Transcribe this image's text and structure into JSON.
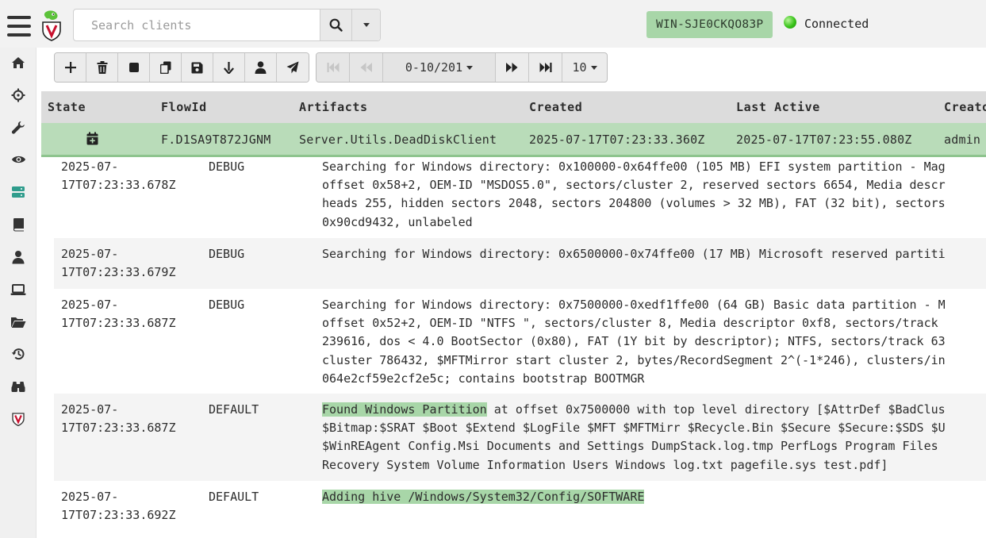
{
  "app": {
    "search_placeholder": "Search clients",
    "client_id": "WIN-SJE0CKQO83P",
    "connection_status": "Connected"
  },
  "sidebar": {
    "items": [
      {
        "name": "home",
        "icon": "home-icon"
      },
      {
        "name": "hunt",
        "icon": "crosshair-icon"
      },
      {
        "name": "tools",
        "icon": "wrench-icon"
      },
      {
        "name": "view",
        "icon": "eye-icon"
      },
      {
        "name": "servers",
        "icon": "server-icon",
        "active": true
      },
      {
        "name": "notebook",
        "icon": "book-icon"
      },
      {
        "name": "users",
        "icon": "user-icon"
      },
      {
        "name": "clients",
        "icon": "laptop-icon"
      },
      {
        "name": "files",
        "icon": "folder-icon"
      },
      {
        "name": "history",
        "icon": "history-icon"
      },
      {
        "name": "search",
        "icon": "binoculars-icon"
      },
      {
        "name": "velociraptor",
        "icon": "shield-v-icon"
      }
    ]
  },
  "toolbar": {
    "buttons": [
      "plus-icon",
      "trash-icon",
      "stop-icon",
      "copy-icon",
      "save-icon",
      "download-icon",
      "user-icon",
      "send-icon"
    ]
  },
  "pager": {
    "range": "0-10/201",
    "page_size": "10"
  },
  "flows_table": {
    "headers": [
      "State",
      "FlowId",
      "Artifacts",
      "Created",
      "Last Active",
      "Creator"
    ],
    "header_visible": [
      "State",
      "FlowId",
      "Artifacts",
      "Created",
      "Last Active",
      "Creato"
    ],
    "row": {
      "state_icon": "calendar-plus-icon",
      "flow_id": "F.D1SA9T872JGNM",
      "artifacts": "Server.Utils.DeadDiskClient",
      "created": "2025-07-17T07:23:33.360Z",
      "last_active": "2025-07-17T07:23:55.080Z",
      "creator": "admin"
    }
  },
  "logs": [
    {
      "time": "2025-07-\n17T07:23:33.678Z",
      "level": "DEBUG",
      "message": "Searching for Windows directory: 0x100000-0x64ffe00 (105 MB) EFI system partition - Mag\noffset 0x58+2, OEM-ID \"MSDOS5.0\", sectors/cluster 2, reserved sectors 6654, Media descr\nheads 255, hidden sectors 2048, sectors 204800 (volumes > 32 MB), FAT (32 bit), sectors\n0x90cd9432, unlabeled"
    },
    {
      "time": "2025-07-\n17T07:23:33.679Z",
      "level": "DEBUG",
      "message": "Searching for Windows directory: 0x6500000-0x74ffe00 (17 MB) Microsoft reserved partiti"
    },
    {
      "time": "2025-07-\n17T07:23:33.687Z",
      "level": "DEBUG",
      "message": "Searching for Windows directory: 0x7500000-0xedf1ffe00 (64 GB) Basic data partition - M\noffset 0x52+2, OEM-ID \"NTFS \", sectors/cluster 8, Media descriptor 0xf8, sectors/track\n239616, dos < 4.0 BootSector (0x80), FAT (1Y bit by descriptor); NTFS, sectors/track 63\ncluster 786432, $MFTMirror start cluster 2, bytes/RecordSegment 2^(-1*246), clusters/in\n064e2cf59e2cf2e5c; contains bootstrap BOOTMGR"
    },
    {
      "time": "2025-07-\n17T07:23:33.687Z",
      "level": "DEFAULT",
      "message_highlight": "Found Windows Partition",
      "message_rest": " at offset 0x7500000 with top level directory [$AttrDef $BadClus\n$Bitmap:$SRAT $Boot $Extend $LogFile $MFT $MFTMirr $Recycle.Bin $Secure $Secure:$SDS $U\n$WinREAgent Config.Msi Documents and Settings DumpStack.log.tmp PerfLogs Program Files\nRecovery System Volume Information Users Windows log.txt pagefile.sys test.pdf]"
    },
    {
      "time": "2025-07-\n17T07:23:33.692Z",
      "level": "DEFAULT",
      "message_highlight": "Adding hive /Windows/System32/Config/SOFTWARE",
      "message_rest": ""
    }
  ]
}
